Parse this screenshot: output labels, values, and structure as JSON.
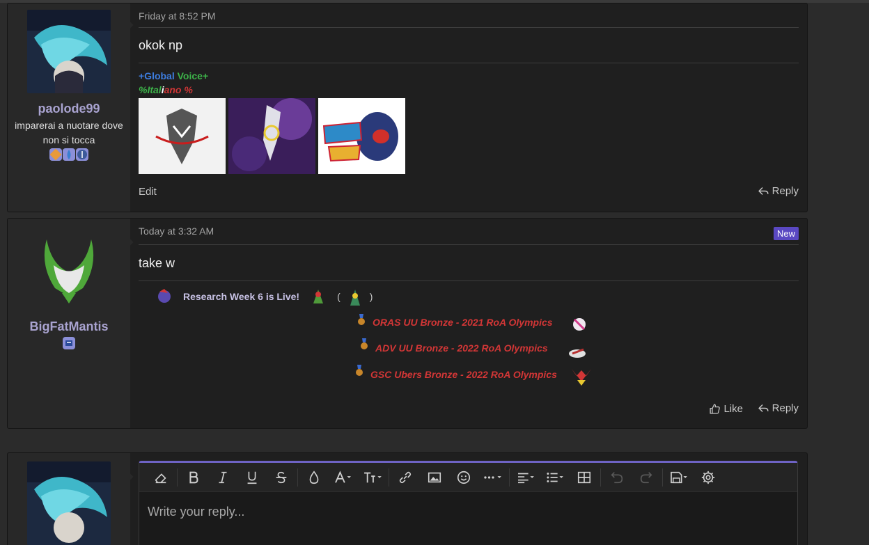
{
  "posts": [
    {
      "username": "paolode99",
      "user_title": "imparerai a nuotare dove non si tocca",
      "timestamp": "Friday at 8:52 PM",
      "text": "okok np",
      "signature": {
        "line1_a": "+Global",
        "line1_b": "Voice+",
        "line2_a": "%Ital",
        "line2_b": "i",
        "line2_c": "ano %"
      },
      "actions": {
        "edit": "Edit",
        "reply": "Reply"
      }
    },
    {
      "username": "BigFatMantis",
      "timestamp": "Today at 3:32 AM",
      "new_badge": "New",
      "text": "take w",
      "signature": {
        "research": "Research Week 6 is Live!",
        "paren_open": "(",
        "paren_close": ")",
        "awards": [
          "ORAS UU Bronze - 2021 RoA Olympics",
          "ADV UU Bronze - 2022 RoA Olympics",
          "GSC Ubers Bronze - 2022 RoA Olympics"
        ]
      },
      "actions": {
        "like": "Like",
        "reply": "Reply"
      }
    }
  ],
  "editor": {
    "placeholder": "Write your reply..."
  },
  "colors": {
    "accent": "#6e63c4",
    "username": "#a9a3d0",
    "award_red": "#d23636",
    "global_blue": "#3d7de0",
    "voice_green": "#3db34a"
  }
}
